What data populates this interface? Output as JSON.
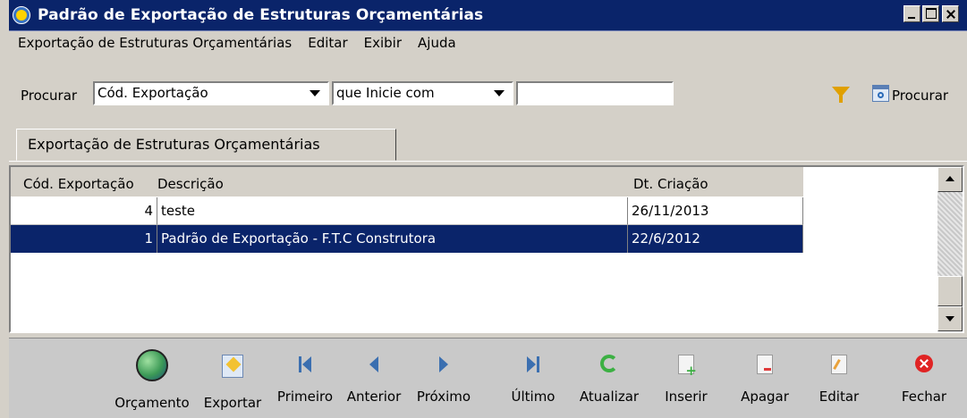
{
  "window": {
    "title": "Padrão de Exportação de Estruturas Orçamentárias"
  },
  "menu": {
    "items": [
      "Exportação de Estruturas Orçamentárias",
      "Editar",
      "Exibir",
      "Ajuda"
    ]
  },
  "search": {
    "label": "Procurar",
    "field_value": "Cód. Exportação",
    "condition_value": "que Inicie com",
    "text_value": "",
    "button_label": "Procurar"
  },
  "tab": {
    "label": "Exportação de Estruturas Orçamentárias"
  },
  "table": {
    "columns": [
      "Cód. Exportação",
      "Descrição",
      "Dt. Criação"
    ],
    "rows": [
      {
        "cod": "4",
        "desc": "teste",
        "dt": "26/11/2013"
      },
      {
        "cod": "1",
        "desc": "Padrão de Exportação - F.T.C Construtora",
        "dt": "22/6/2012"
      }
    ],
    "selected_row": 1
  },
  "toolbar": {
    "orcamento": "Orçamento",
    "exportar": "Exportar",
    "primeiro": "Primeiro",
    "anterior": "Anterior",
    "proximo": "Próximo",
    "ultimo": "Último",
    "atualizar": "Atualizar",
    "inserir": "Inserir",
    "apagar": "Apagar",
    "editar": "Editar",
    "fechar": "Fechar"
  },
  "colors": {
    "titlebar": "#0a246a",
    "selection": "#0a246a",
    "face": "#d4d0c8"
  }
}
